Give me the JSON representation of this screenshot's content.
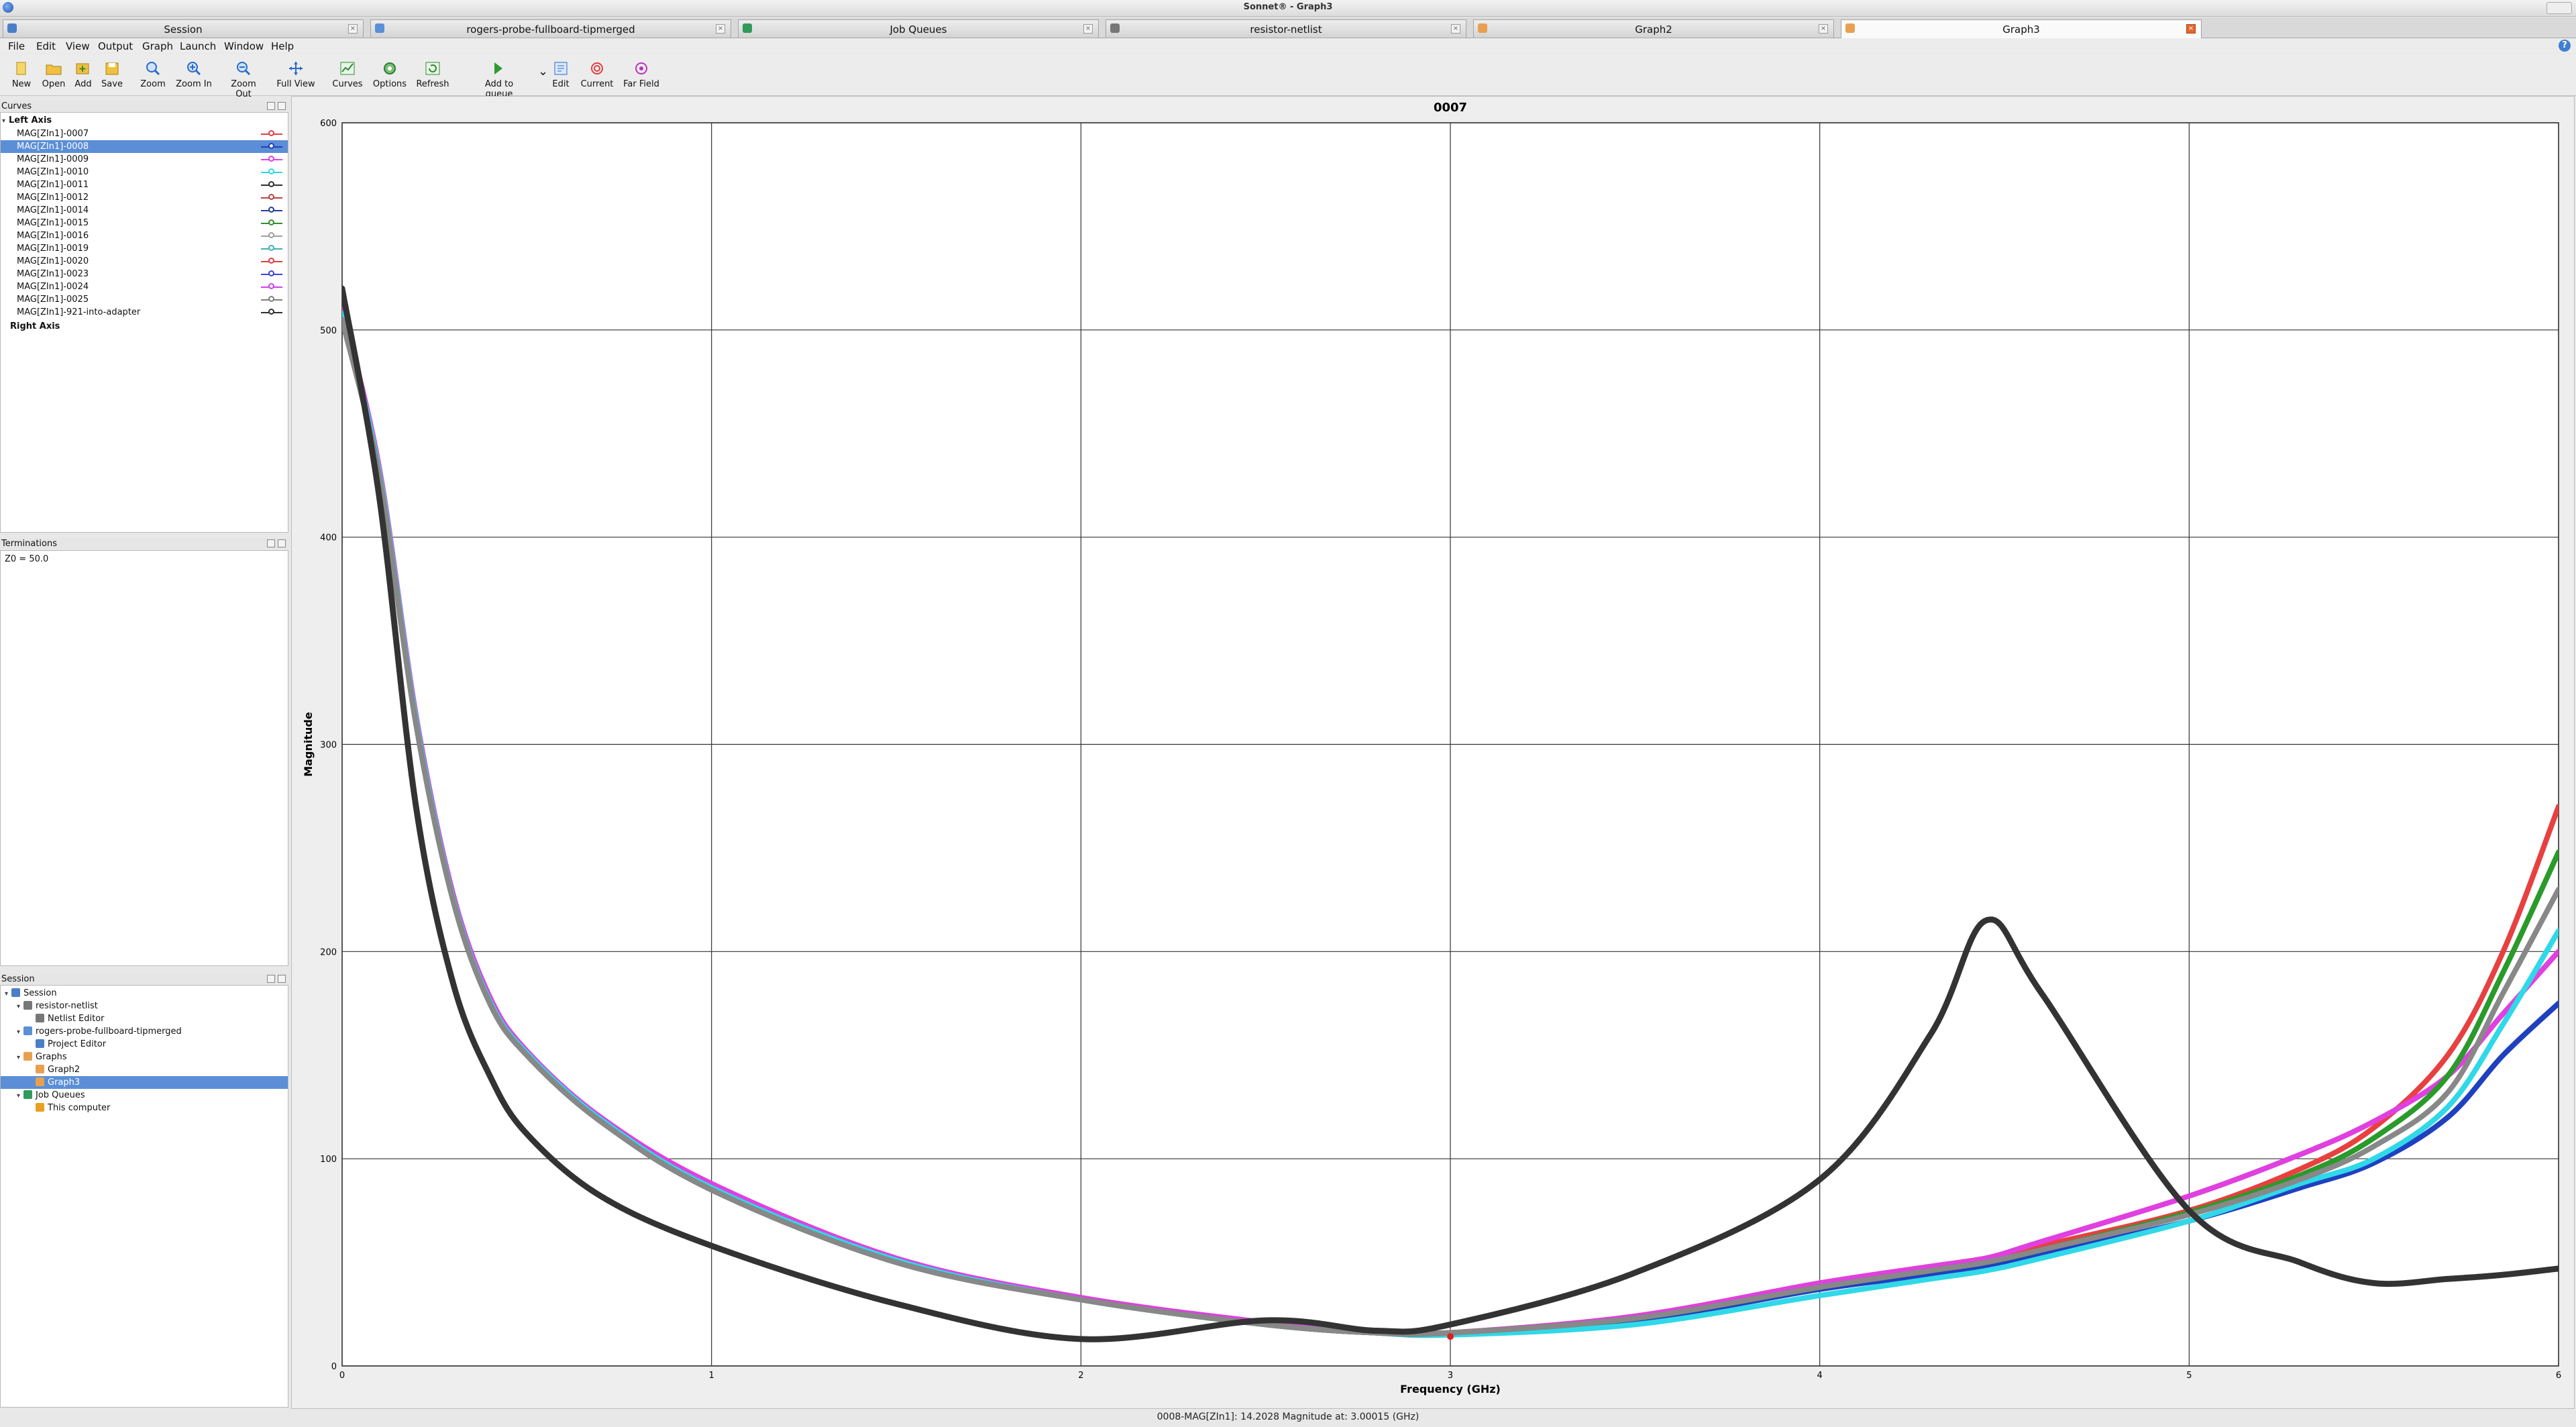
{
  "window": {
    "title": "Sonnet® - Graph3"
  },
  "tabs": [
    {
      "label": "Session",
      "icon": "session-icon",
      "active": false
    },
    {
      "label": "rogers-probe-fullboard-tipmerged",
      "icon": "project-icon",
      "active": false
    },
    {
      "label": "Job Queues",
      "icon": "job-queue-icon",
      "active": false
    },
    {
      "label": "resistor-netlist",
      "icon": "netlist-icon",
      "active": false
    },
    {
      "label": "Graph2",
      "icon": "graph-icon",
      "active": false
    },
    {
      "label": "Graph3",
      "icon": "graph-icon",
      "active": true
    }
  ],
  "menu": [
    "File",
    "Edit",
    "View",
    "Output",
    "Graph",
    "Launch",
    "Window",
    "Help"
  ],
  "toolbar": [
    {
      "label": "New",
      "icon": "new-file-icon"
    },
    {
      "label": "Open",
      "icon": "open-folder-icon"
    },
    {
      "label": "Add",
      "icon": "add-icon"
    },
    {
      "label": "Save",
      "icon": "save-icon"
    },
    {
      "label": "Zoom",
      "icon": "zoom-icon"
    },
    {
      "label": "Zoom In",
      "icon": "zoom-in-icon"
    },
    {
      "label": "Zoom Out",
      "icon": "zoom-out-icon"
    },
    {
      "label": "Full View",
      "icon": "full-view-icon"
    },
    {
      "label": "Curves",
      "icon": "curves-icon"
    },
    {
      "label": "Options",
      "icon": "options-icon"
    },
    {
      "label": "Refresh",
      "icon": "refresh-icon"
    },
    {
      "label": "Add to queue",
      "icon": "add-to-queue-icon"
    },
    {
      "label": "Edit",
      "icon": "edit-icon"
    },
    {
      "label": "Current",
      "icon": "current-icon"
    },
    {
      "label": "Far Field",
      "icon": "far-field-icon"
    }
  ],
  "curves_panel": {
    "title": "Curves",
    "left_axis_label": "Left Axis",
    "right_axis_label": "Right Axis",
    "items": [
      {
        "name": "MAG[ZIn1]-0007",
        "color": "#e04040"
      },
      {
        "name": "MAG[ZIn1]-0008",
        "color": "#2040c0",
        "selected": true
      },
      {
        "name": "MAG[ZIn1]-0009",
        "color": "#e040e0"
      },
      {
        "name": "MAG[ZIn1]-0010",
        "color": "#30d8e8"
      },
      {
        "name": "MAG[ZIn1]-0011",
        "color": "#303030"
      },
      {
        "name": "MAG[ZIn1]-0012",
        "color": "#c04040"
      },
      {
        "name": "MAG[ZIn1]-0014",
        "color": "#2040a0"
      },
      {
        "name": "MAG[ZIn1]-0015",
        "color": "#309030"
      },
      {
        "name": "MAG[ZIn1]-0016",
        "color": "#a0a0a0"
      },
      {
        "name": "MAG[ZIn1]-0019",
        "color": "#40b0b0"
      },
      {
        "name": "MAG[ZIn1]-0020",
        "color": "#e04040"
      },
      {
        "name": "MAG[ZIn1]-0023",
        "color": "#4040e0"
      },
      {
        "name": "MAG[ZIn1]-0024",
        "color": "#d040f0"
      },
      {
        "name": "MAG[ZIn1]-0025",
        "color": "#808080"
      },
      {
        "name": "MAG[ZIn1]-921-into-adapter",
        "color": "#303030"
      }
    ]
  },
  "terminations_panel": {
    "title": "Terminations",
    "text": "Z0 = 50.0"
  },
  "session_panel": {
    "title": "Session",
    "tree": [
      {
        "label": "Session",
        "depth": 0,
        "icon": "session-icon",
        "twisty": "v"
      },
      {
        "label": "resistor-netlist",
        "depth": 1,
        "icon": "netlist-icon",
        "twisty": "v"
      },
      {
        "label": "Netlist Editor",
        "depth": 2,
        "icon": "netlist-editor-icon"
      },
      {
        "label": "rogers-probe-fullboard-tipmerged",
        "depth": 1,
        "icon": "project-icon",
        "twisty": "v"
      },
      {
        "label": "Project Editor",
        "depth": 2,
        "icon": "project-editor-icon"
      },
      {
        "label": "Graphs",
        "depth": 1,
        "icon": "graph-folder-icon",
        "twisty": "v"
      },
      {
        "label": "Graph2",
        "depth": 2,
        "icon": "graph-icon"
      },
      {
        "label": "Graph3",
        "depth": 2,
        "icon": "graph-icon",
        "selected": true
      },
      {
        "label": "Job Queues",
        "depth": 1,
        "icon": "job-queue-icon",
        "twisty": "v"
      },
      {
        "label": "This computer",
        "depth": 2,
        "icon": "warning-icon"
      }
    ]
  },
  "status_bar": {
    "text": "0008-MAG[ZIn1]: 14.2028 Magnitude at: 3.00015 (GHz)"
  },
  "chart_data": {
    "type": "line",
    "title": "0007",
    "xlabel": "Frequency (GHz)",
    "ylabel": "Magnitude",
    "xlim": [
      0,
      6
    ],
    "ylim": [
      0,
      600
    ],
    "xticks": [
      "0",
      "1",
      "2",
      "3",
      "4",
      "5",
      "6"
    ],
    "yticks": [
      "0",
      "100",
      "200",
      "300",
      "400",
      "500",
      "600"
    ],
    "grid": true,
    "marker": {
      "x": 3.00015,
      "y": 14.2028
    },
    "x": [
      0,
      0.1,
      0.2,
      0.3,
      0.4,
      0.5,
      0.7,
      1.0,
      1.5,
      2.0,
      2.5,
      2.8,
      3.0,
      3.5,
      4.0,
      4.3,
      4.45,
      4.6,
      5.0,
      5.3,
      5.5,
      5.7,
      5.85,
      6.0
    ],
    "series": [
      {
        "name": "MAG[ZIn1]-0007",
        "color": "#e84040",
        "values": [
          505,
          430,
          310,
          225,
          175,
          150,
          118,
          85,
          50,
          32,
          20,
          16,
          16,
          24,
          40,
          48,
          52,
          58,
          75,
          95,
          115,
          150,
          200,
          270
        ]
      },
      {
        "name": "MAG[ZIn1]-0008",
        "color": "#2040c0",
        "values": [
          505,
          430,
          310,
          225,
          175,
          150,
          118,
          85,
          50,
          32,
          20,
          16,
          16,
          22,
          37,
          44,
          48,
          54,
          70,
          86,
          98,
          120,
          150,
          175
        ]
      },
      {
        "name": "MAG[ZIn1]-0009",
        "color": "#e040e0",
        "values": [
          510,
          434,
          314,
          228,
          178,
          152,
          120,
          88,
          52,
          33,
          21,
          16,
          16,
          24,
          40,
          48,
          52,
          60,
          82,
          102,
          118,
          140,
          170,
          200
        ]
      },
      {
        "name": "MAG[ZIn1]-0010",
        "color": "#30d8e8",
        "values": [
          508,
          432,
          312,
          226,
          176,
          151,
          119,
          86,
          51,
          32,
          20,
          16,
          15,
          20,
          34,
          42,
          46,
          52,
          70,
          88,
          100,
          125,
          165,
          210
        ]
      },
      {
        "name": "MAG[ZIn1]-0015",
        "color": "#2a9a2a",
        "values": [
          505,
          430,
          310,
          225,
          175,
          150,
          118,
          85,
          50,
          32,
          20,
          16,
          16,
          23,
          38,
          46,
          50,
          56,
          74,
          92,
          110,
          140,
          190,
          248
        ]
      },
      {
        "name": "MAG[ZIn1]-0025",
        "color": "#888888",
        "values": [
          505,
          430,
          310,
          225,
          175,
          150,
          118,
          85,
          50,
          32,
          20,
          16,
          16,
          23,
          38,
          46,
          50,
          56,
          73,
          90,
          106,
          132,
          180,
          230
        ]
      },
      {
        "name": "MAG[ZIn1]-921-into-adapter",
        "color": "#333333",
        "values": [
          520,
          420,
          270,
          185,
          140,
          112,
          82,
          58,
          30,
          13,
          22,
          17,
          20,
          45,
          90,
          160,
          215,
          180,
          75,
          50,
          40,
          42,
          44,
          47
        ]
      }
    ]
  }
}
